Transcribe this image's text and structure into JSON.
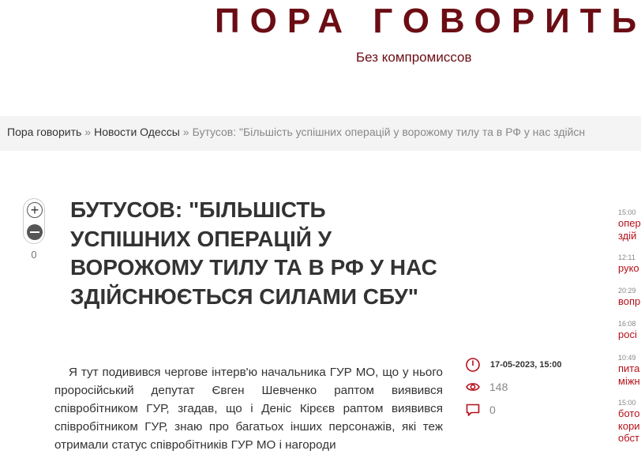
{
  "header": {
    "site_title": "ПОРА ГОВОРИТЬ",
    "tagline": "Без компромиссов"
  },
  "breadcrumb": {
    "items": [
      "Пора говорить",
      "Новости Одессы"
    ],
    "separator": "»",
    "current": "Бутусов: \"Більшість успішних операцій у ворожому тилу та в РФ у нас здійсн"
  },
  "vote": {
    "plus": "+",
    "count": "0"
  },
  "article": {
    "title": "Бутусов: \"Більшість успішних операцій у ворожому тилу та в РФ у нас здійснюється силами СБУ\"",
    "body": "Я тут подивився чергове інтерв'ю начальника ГУР МО, що у нього проросійський депутат Євген Шевченко раптом виявився співробітником ГУР, згадав, що і Деніс Кірєєв раптом виявився співробітником ГУР, знаю про багатьох інших персонажів, які теж отримали статус співробітників ГУР МО і нагороди"
  },
  "meta": {
    "date": "17-05-2023, 15:00",
    "views": "148",
    "comments": "0"
  },
  "sidebar": {
    "items": [
      {
        "time": "15:00",
        "lines": [
          "опер",
          "здій"
        ]
      },
      {
        "time": "12:11",
        "lines": [
          "руко"
        ]
      },
      {
        "time": "20:29",
        "lines": [
          "вопр"
        ]
      },
      {
        "time": "16:08",
        "lines": [
          "росі"
        ]
      },
      {
        "time": "10:49",
        "lines": [
          "пита",
          "міжн"
        ]
      },
      {
        "time": "15:00",
        "lines": [
          "бото",
          "кори",
          "обст"
        ]
      }
    ]
  },
  "colors": {
    "brand": "#6b0d14",
    "link_red": "#b5101a",
    "text": "#333333"
  }
}
